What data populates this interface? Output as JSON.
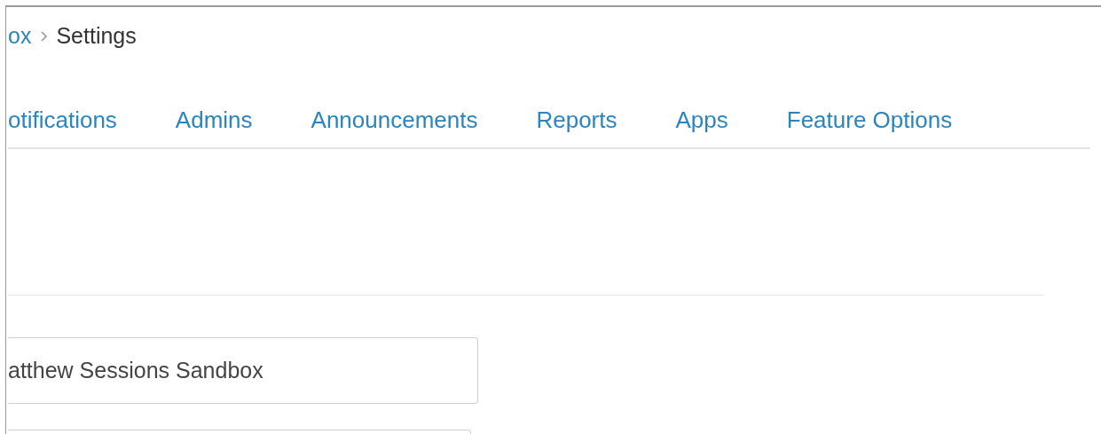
{
  "breadcrumb": [
    {
      "text": "ox",
      "kind": "link"
    },
    {
      "text": "Settings",
      "kind": "current"
    }
  ],
  "tabs": [
    "otifications",
    "Admins",
    "Announcements",
    "Reports",
    "Apps",
    "Feature Options"
  ],
  "form": {
    "name_field": {
      "value": "atthew Sessions Sandbox"
    }
  }
}
